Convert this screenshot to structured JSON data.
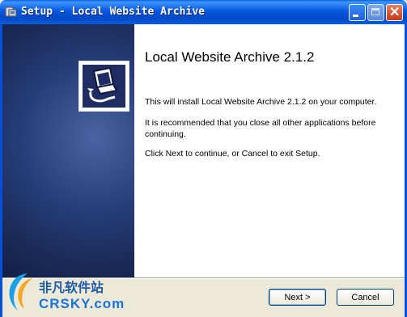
{
  "window": {
    "title": "Setup - Local Website Archive",
    "controls": {
      "minimize_icon": "minimize-icon",
      "maximize_icon": "maximize-icon",
      "close_icon": "close-icon"
    }
  },
  "welcome": {
    "heading": "Local Website Archive 2.1.2",
    "paragraphs": [
      "This will install Local Website Archive 2.1.2 on your computer.",
      "It is recommended that you close all other applications before continuing.",
      "Click Next to continue, or Cancel to exit Setup."
    ]
  },
  "buttons": {
    "next": "Next >",
    "cancel": "Cancel"
  },
  "watermark": {
    "line1": "非凡软件站",
    "line2": "CRSKY.com"
  },
  "colors": {
    "titlebar": "#0858e0",
    "side_panel": "#253d78",
    "watermark_blue": "#1a73d9"
  }
}
